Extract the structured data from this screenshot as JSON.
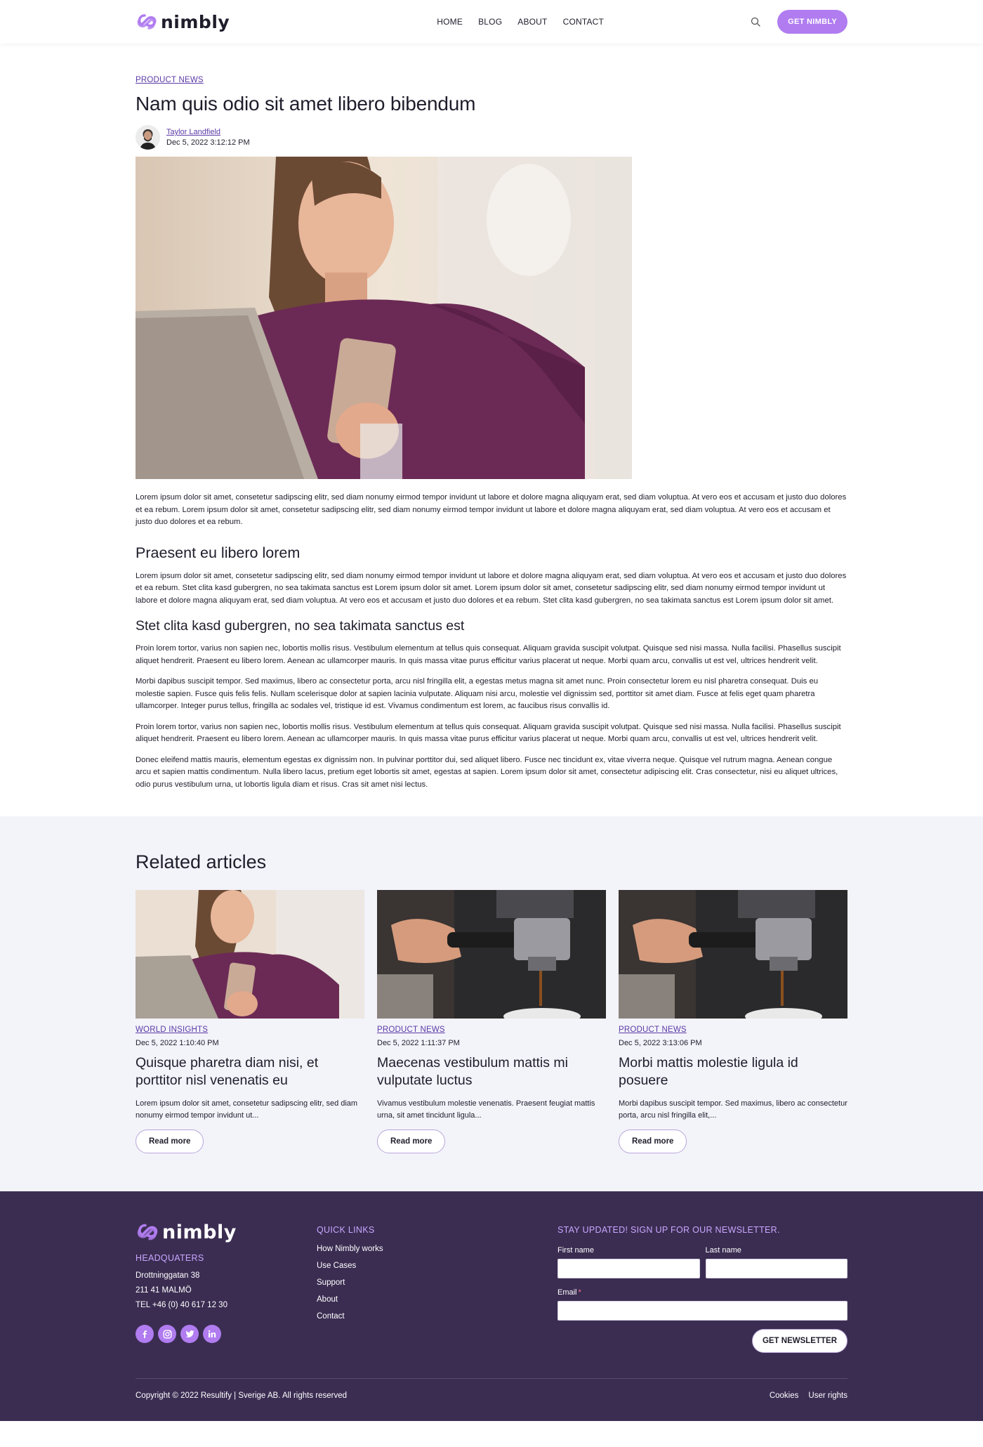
{
  "brand": {
    "name": "nimbly",
    "accent": "#b07cf0",
    "footer_bg": "#3b2d52"
  },
  "header": {
    "nav": [
      "HOME",
      "BLOG",
      "ABOUT",
      "CONTACT"
    ],
    "cta": "GET NIMBLY"
  },
  "article": {
    "category": "PRODUCT NEWS",
    "title": "Nam quis odio sit amet libero bibendum",
    "author": "Taylor Landfield",
    "date": "Dec 5, 2022 3:12:12 PM",
    "p1": "Lorem ipsum dolor sit amet, consetetur sadipscing elitr, sed diam nonumy eirmod tempor invidunt ut labore et dolore magna aliquyam erat, sed diam voluptua. At vero eos et accusam et justo duo dolores et ea rebum. Lorem ipsum dolor sit amet, consetetur sadipscing elitr, sed diam nonumy eirmod tempor invidunt ut labore et dolore magna aliquyam erat, sed diam voluptua. At vero eos et accusam et justo duo dolores et ea rebum.",
    "h2": "Praesent eu libero lorem",
    "p2": "Lorem ipsum dolor sit amet, consetetur sadipscing elitr, sed diam nonumy eirmod tempor invidunt ut labore et dolore magna aliquyam erat, sed diam voluptua. At vero eos et accusam et justo duo dolores et ea rebum. Stet clita kasd gubergren, no sea takimata sanctus est Lorem ipsum dolor sit amet. Lorem ipsum dolor sit amet, consetetur sadipscing elitr, sed diam nonumy eirmod tempor invidunt ut labore et dolore magna aliquyam erat, sed diam voluptua. At vero eos et accusam et justo duo dolores et ea rebum. Stet clita kasd gubergren, no sea takimata sanctus est Lorem ipsum dolor sit amet.",
    "h3": "Stet clita kasd gubergren, no sea takimata sanctus est",
    "p3": "Proin lorem tortor, varius non sapien nec, lobortis mollis risus. Vestibulum elementum at tellus quis consequat. Aliquam gravida suscipit volutpat. Quisque sed nisi massa. Nulla facilisi. Phasellus suscipit aliquet hendrerit. Praesent eu libero lorem. Aenean ac ullamcorper mauris. In quis massa vitae purus efficitur varius placerat ut neque. Morbi quam arcu, convallis ut est vel, ultrices hendrerit velit.",
    "p4": "Morbi dapibus suscipit tempor. Sed maximus, libero ac consectetur porta, arcu nisl fringilla elit, a egestas metus magna sit amet nunc. Proin consectetur lorem eu nisl pharetra consequat. Duis eu molestie sapien. Fusce quis felis felis. Nullam scelerisque dolor at sapien lacinia vulputate. Aliquam nisi arcu, molestie vel dignissim sed, porttitor sit amet diam. Fusce at felis eget quam pharetra ullamcorper. Integer purus tellus, fringilla ac sodales vel, tristique id est. Vivamus condimentum est lorem, ac faucibus risus convallis id.",
    "p5": "Proin lorem tortor, varius non sapien nec, lobortis mollis risus. Vestibulum elementum at tellus quis consequat. Aliquam gravida suscipit volutpat. Quisque sed nisi massa. Nulla facilisi. Phasellus suscipit aliquet hendrerit. Praesent eu libero lorem. Aenean ac ullamcorper mauris. In quis massa vitae purus efficitur varius placerat ut neque. Morbi quam arcu, convallis ut est vel, ultrices hendrerit velit.",
    "p6": "Donec eleifend mattis mauris, elementum egestas ex dignissim non. In pulvinar porttitor dui, sed aliquet libero. Fusce nec tincidunt ex, vitae viverra neque. Quisque vel rutrum magna. Aenean congue arcu et sapien mattis condimentum. Nulla libero lacus, pretium eget lobortis sit amet, egestas at sapien. Lorem ipsum dolor sit amet, consectetur adipiscing elit. Cras consectetur, nisi eu aliquet ultrices, odio purus vestibulum urna, ut lobortis ligula diam et risus. Cras sit amet nisi lectus."
  },
  "related": {
    "title": "Related articles",
    "cards": [
      {
        "category": "WORLD INSIGHTS",
        "date": "Dec 5, 2022 1:10:40 PM",
        "title": "Quisque pharetra diam nisi, et porttitor nisl venenatis eu",
        "excerpt": "Lorem ipsum dolor sit amet, consetetur sadipscing elitr, sed diam nonumy eirmod tempor invidunt ut...",
        "button": "Read more"
      },
      {
        "category": "PRODUCT NEWS",
        "date": "Dec 5, 2022 1:11:37 PM",
        "title": "Maecenas vestibulum mattis mi vulputate luctus",
        "excerpt": "Vivamus vestibulum molestie venenatis. Praesent feugiat mattis urna, sit amet tincidunt ligula...",
        "button": "Read more"
      },
      {
        "category": "PRODUCT NEWS",
        "date": "Dec 5, 2022 3:13:06 PM",
        "title": "Morbi mattis molestie ligula id posuere",
        "excerpt": "Morbi dapibus suscipit tempor. Sed maximus, libero ac consectetur porta, arcu nisl fringilla elit,...",
        "button": "Read more"
      }
    ]
  },
  "footer": {
    "hq_heading": "HEADQUATERS",
    "address1": "Drottninggatan 38",
    "address2": "211 41 MALMÖ",
    "phone": "TEL +46 (0) 40 617 12 30",
    "quick_links_heading": "QUICK LINKS",
    "quick_links": [
      "How Nimbly works",
      "Use Cases",
      "Support",
      "About",
      "Contact"
    ],
    "newsletter_heading": "STAY UPDATED! SIGN UP FOR OUR NEWSLETTER.",
    "first_name_label": "First name",
    "last_name_label": "Last name",
    "email_label": "Email",
    "required_mark": "*",
    "newsletter_button": "GET NEWSLETTER",
    "copyright": "Copyright © 2022 Resultify | Sverige AB. All rights reserved",
    "legal_links": [
      "Cookies",
      "User rights"
    ],
    "socials": [
      "facebook-icon",
      "instagram-icon",
      "twitter-icon",
      "linkedin-icon"
    ]
  }
}
